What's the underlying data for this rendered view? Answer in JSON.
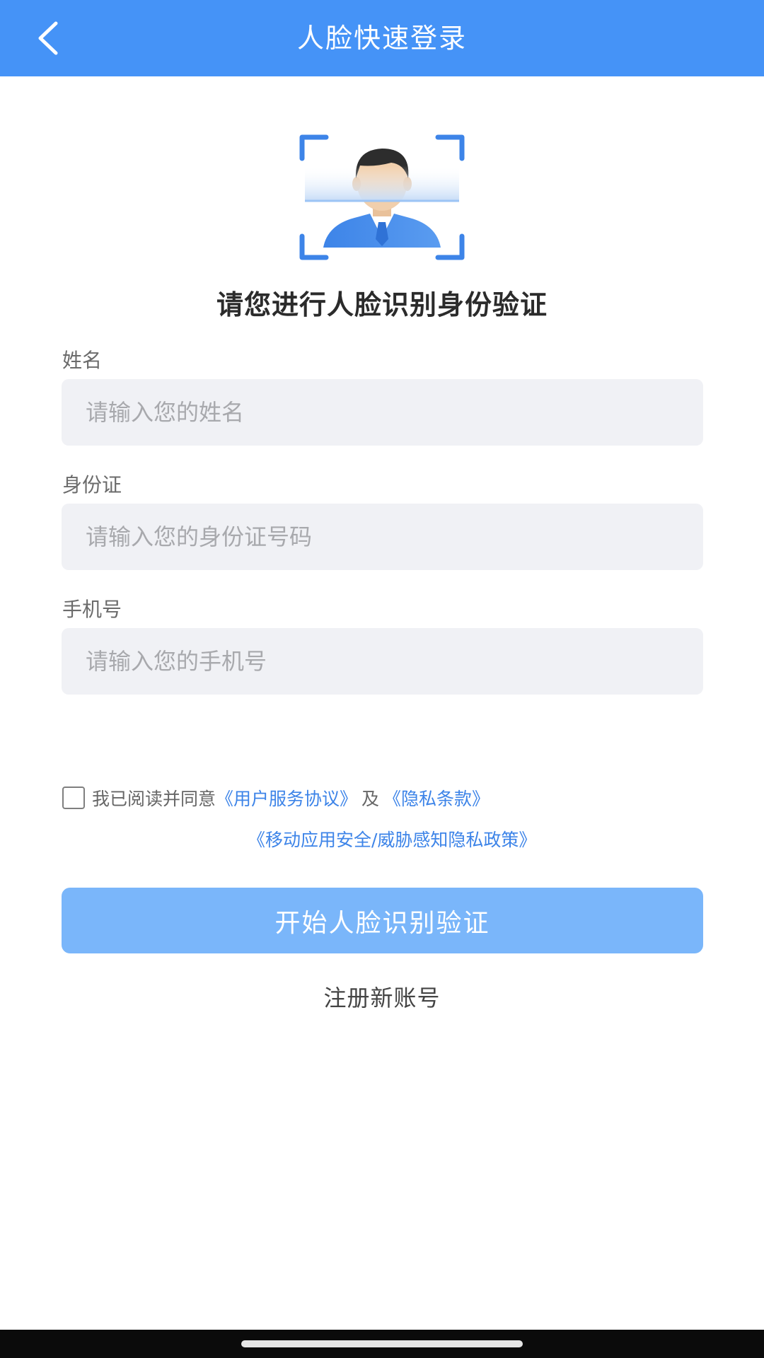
{
  "header": {
    "title": "人脸快速登录",
    "back_icon": "chevron-left-icon",
    "background_color": "#4593F7"
  },
  "illustration": {
    "icon": "face-scan-icon",
    "accent_color": "#3D84E8"
  },
  "prompt": "请您进行人脸识别身份验证",
  "form": {
    "name": {
      "label": "姓名",
      "placeholder": "请输入您的姓名",
      "value": ""
    },
    "id_card": {
      "label": "身份证",
      "placeholder": "请输入您的身份证号码",
      "value": ""
    },
    "phone": {
      "label": "手机号",
      "placeholder": "请输入您的手机号",
      "value": ""
    }
  },
  "agreement": {
    "checked": false,
    "text": "我已阅读并同意",
    "user_agreement": "《用户服务协议》",
    "and": "及",
    "privacy_terms": "《隐私条款》",
    "security_policy": "《移动应用安全/威胁感知隐私政策》",
    "link_color": "#3D84E8"
  },
  "actions": {
    "start_button": "开始人脸识别验证",
    "start_button_color": "#7AB6FA",
    "register_link": "注册新账号"
  }
}
